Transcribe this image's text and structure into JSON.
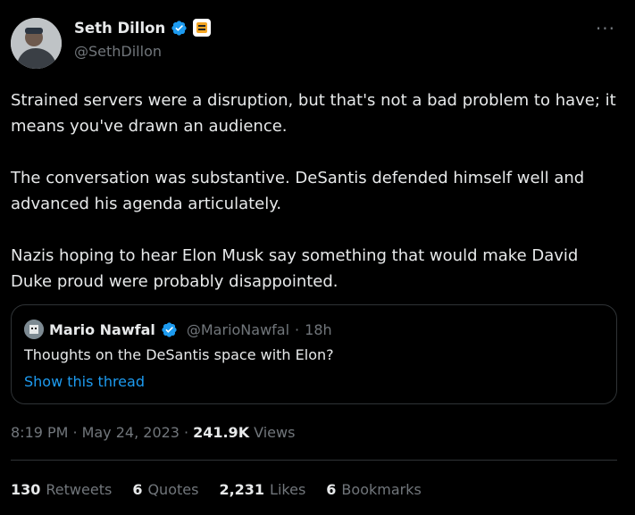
{
  "author": {
    "display_name": "Seth Dillon",
    "handle": "@SethDillon",
    "avatar_icon": "user-avatar",
    "verified_icon": "verified-badge-icon",
    "affiliation_icon": "babylon-bee-badge-icon",
    "more_icon": "more-options-icon",
    "more_label": "···"
  },
  "tweet": {
    "paragraphs": [
      "Strained servers were a disruption, but that's not a bad problem to have; it means you've drawn an audience.",
      "The conversation was substantive. DeSantis defended himself well and advanced his agenda articulately.",
      "Nazis hoping to hear Elon Musk say something that would make David Duke proud were probably disappointed."
    ]
  },
  "quote": {
    "display_name": "Mario Nawfal",
    "handle": "@MarioNawfal",
    "separator": "·",
    "time": "18h",
    "text": "Thoughts on the DeSantis space with Elon?",
    "link_label": "Show this thread"
  },
  "meta": {
    "time": "8:19 PM",
    "sep1": "·",
    "date": "May 24, 2023",
    "sep2": "·",
    "views_count": "241.9K",
    "views_label": "Views"
  },
  "stats": [
    {
      "num": "130",
      "label": "Retweets"
    },
    {
      "num": "6",
      "label": "Quotes"
    },
    {
      "num": "2,231",
      "label": "Likes"
    },
    {
      "num": "6",
      "label": "Bookmarks"
    }
  ],
  "colors": {
    "background": "#000000",
    "text": "#e7e9ea",
    "muted": "#71767b",
    "accent": "#1d9bf0",
    "border": "#2f3336"
  }
}
